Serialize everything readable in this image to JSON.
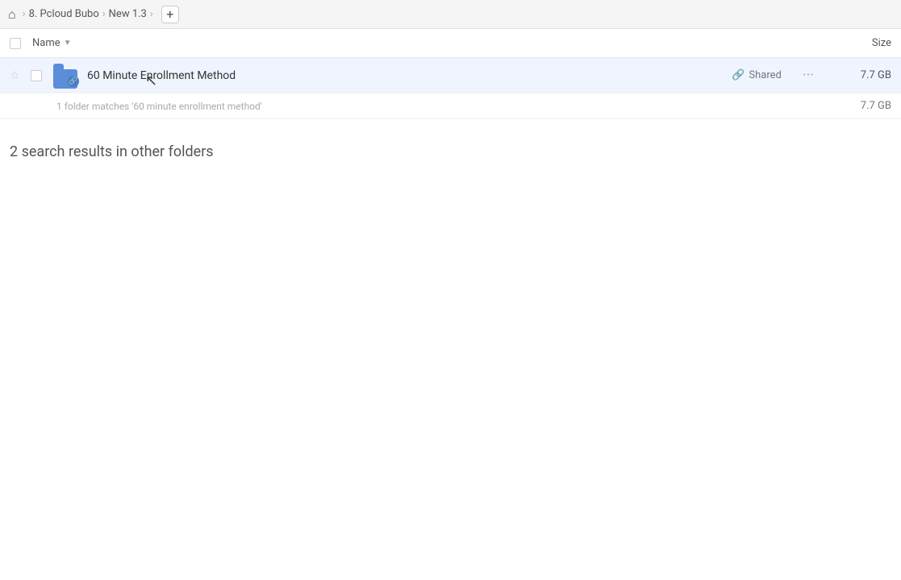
{
  "breadcrumb": {
    "home_icon": "🏠",
    "items": [
      {
        "label": "8. Pcloud Bubo"
      },
      {
        "label": "New 1.3"
      }
    ],
    "add_icon": "+"
  },
  "columns": {
    "name_label": "Name",
    "size_label": "Size"
  },
  "file_row": {
    "folder_name": "60 Minute Enrollment Method",
    "shared_label": "Shared",
    "size": "7.7 GB",
    "more_icon": "···"
  },
  "match_info": {
    "text": "1 folder matches '60 minute enrollment method'",
    "size": "7.7 GB"
  },
  "other_results": {
    "heading": "2 search results in other folders"
  }
}
